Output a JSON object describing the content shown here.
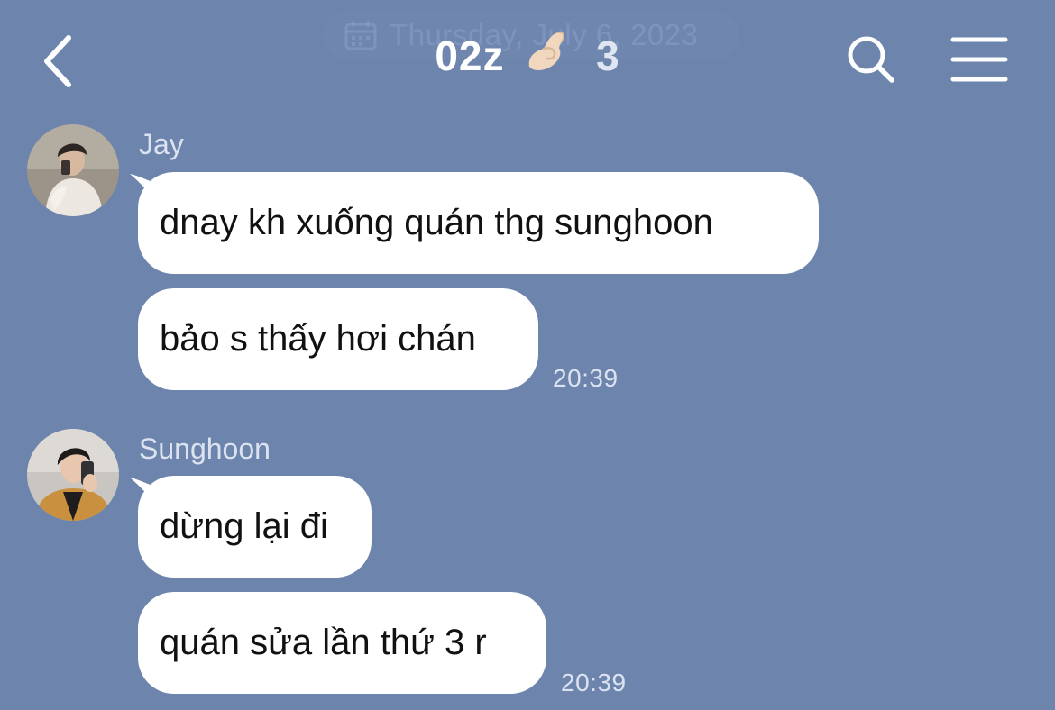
{
  "header": {
    "date_label": "Thursday, July 6, 2023",
    "title": "02z",
    "member_count": "3"
  },
  "icons": {
    "back": "chevron-left-icon",
    "search": "search-icon",
    "menu": "hamburger-menu-icon",
    "calendar": "calendar-icon",
    "title_emoji": "pinching-hand-emoji"
  },
  "colors": {
    "background": "#6d84ac",
    "bubble": "#ffffff",
    "secondary_text": "#dbe3f0"
  },
  "messages": [
    {
      "sender": "Jay",
      "bubbles": [
        "dnay kh xuống quán thg sunghoon",
        "bảo s thấy hơi chán"
      ],
      "time": "20:39"
    },
    {
      "sender": "Sunghoon",
      "bubbles": [
        "dừng lại đi",
        "quán sửa lần thứ 3 r"
      ],
      "time": "20:39"
    }
  ]
}
